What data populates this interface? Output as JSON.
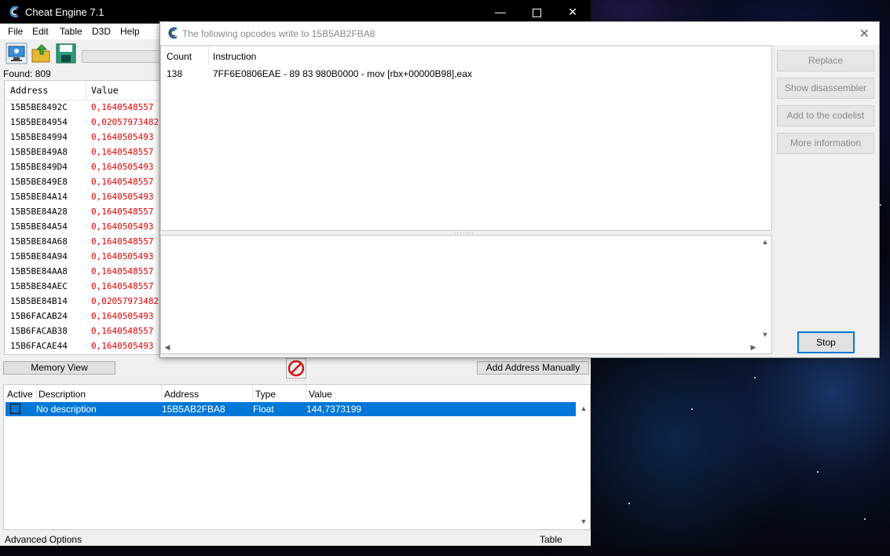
{
  "main_window": {
    "title": "Cheat Engine 7.1",
    "menu": [
      "File",
      "Edit",
      "Table",
      "D3D",
      "Help"
    ],
    "found_label": "Found: 809",
    "results": {
      "col_address": "Address",
      "col_value": "Value",
      "rows": [
        {
          "address": "15B5BE8492C",
          "value": "0,1640548557"
        },
        {
          "address": "15B5BE84954",
          "value": "0,02057973482"
        },
        {
          "address": "15B5BE84994",
          "value": "0,1640505493"
        },
        {
          "address": "15B5BE849A8",
          "value": "0,1640548557"
        },
        {
          "address": "15B5BE849D4",
          "value": "0,1640505493"
        },
        {
          "address": "15B5BE849E8",
          "value": "0,1640548557"
        },
        {
          "address": "15B5BE84A14",
          "value": "0,1640505493"
        },
        {
          "address": "15B5BE84A28",
          "value": "0,1640548557"
        },
        {
          "address": "15B5BE84A54",
          "value": "0,1640505493"
        },
        {
          "address": "15B5BE84A68",
          "value": "0,1640548557"
        },
        {
          "address": "15B5BE84A94",
          "value": "0,1640505493"
        },
        {
          "address": "15B5BE84AA8",
          "value": "0,1640548557"
        },
        {
          "address": "15B5BE84AEC",
          "value": "0,1640548557"
        },
        {
          "address": "15B5BE84B14",
          "value": "0,02057973482"
        },
        {
          "address": "15B6FACAB24",
          "value": "0,1640505493"
        },
        {
          "address": "15B6FACAB38",
          "value": "0,1640548557"
        },
        {
          "address": "15B6FACAE44",
          "value": "0,1640505493"
        }
      ]
    },
    "memory_view_label": "Memory View",
    "add_address_label": "Add Address Manually",
    "address_list": {
      "headers": {
        "active": "Active",
        "description": "Description",
        "address": "Address",
        "type": "Type",
        "value": "Value"
      },
      "rows": [
        {
          "description": "No description",
          "address": "15B5AB2FBA8",
          "type": "Float",
          "value": "144,7373199"
        }
      ]
    },
    "status_left": "Advanced Options",
    "status_right": "Table Extras"
  },
  "opcodes_dialog": {
    "title": "The following opcodes write to 15B5AB2FBA8",
    "col_count": "Count",
    "col_instruction": "Instruction",
    "rows": [
      {
        "count": "138",
        "instruction": "7FF6E0806EAE - 89 83 980B0000  - mov [rbx+00000B98],eax"
      }
    ],
    "buttons": {
      "replace": "Replace",
      "show_disassembler": "Show disassembler",
      "add_codelist": "Add to the codelist",
      "more_info": "More information",
      "stop": "Stop"
    }
  },
  "colors": {
    "value_red": "#e00000",
    "selection_blue": "#0078d7"
  }
}
